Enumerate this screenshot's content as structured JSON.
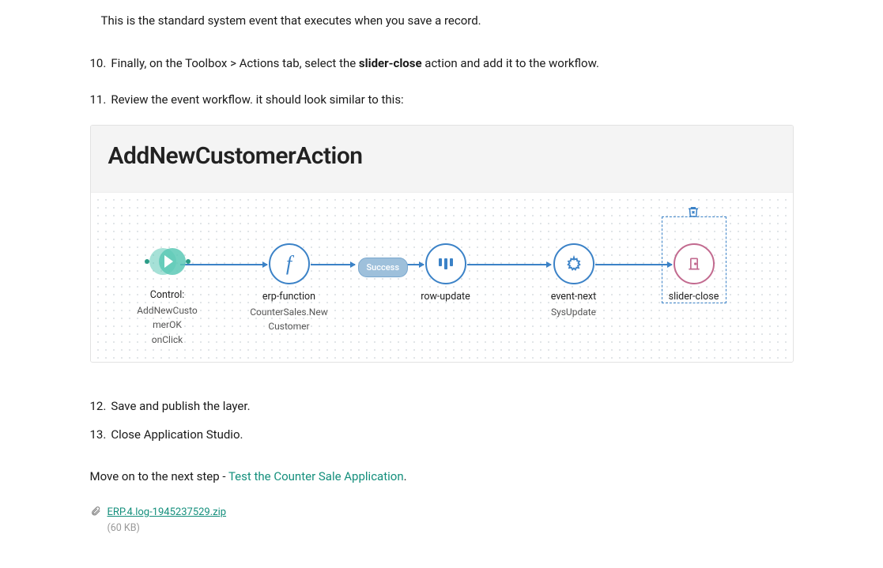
{
  "intro_note": "This is the standard system event that executes when you save a record.",
  "steps": {
    "s10": {
      "num": "10.",
      "pre": "Finally, on the Toolbox > Actions tab, select the ",
      "bold": "slider-close",
      "post": " action and add it to the workflow."
    },
    "s11": {
      "num": "11.",
      "text": "Review the event workflow. it should look similar to this:"
    },
    "s12": {
      "num": "12.",
      "text": "Save and publish the layer."
    },
    "s13": {
      "num": "13.",
      "text": "Close Application Studio."
    }
  },
  "figure": {
    "title": "AddNewCustomerAction",
    "nodes": {
      "start": {
        "l1": "Control:",
        "l2": "AddNewCusto",
        "l3": "merOK",
        "l4": "onClick"
      },
      "erp": {
        "l1": "erp-function",
        "l2": "CounterSales.New",
        "l3": "Customer"
      },
      "row": {
        "l1": "row-update"
      },
      "event": {
        "l1": "event-next",
        "l2": "SysUpdate"
      },
      "slider": {
        "l1": "slider-close"
      }
    },
    "badge": "Success"
  },
  "next": {
    "pre": "Move on to the next step - ",
    "link": "Test the Counter Sale Application",
    "post": "."
  },
  "attachment": {
    "name": "ERP.4.log-1945237529.zip",
    "size": "(60 KB)"
  }
}
